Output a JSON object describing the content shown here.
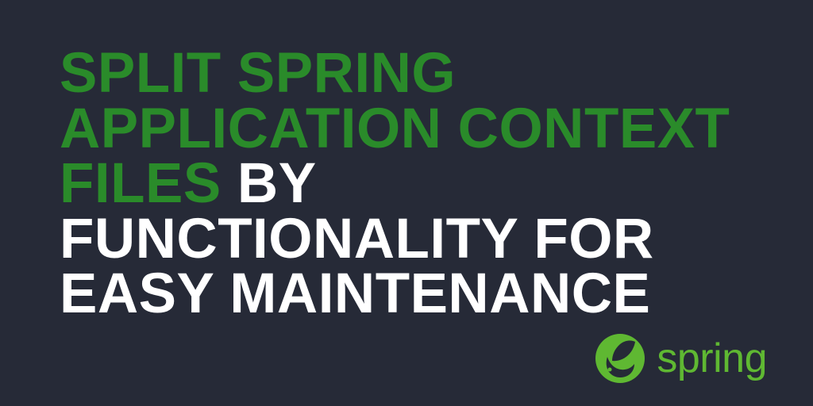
{
  "headline": {
    "emphasis": "Split Spring Application Context Files",
    "rest": " by Functionality for Easy Maintenance"
  },
  "logo": {
    "text": "spring"
  },
  "colors": {
    "background": "#262a37",
    "accent_green": "#2a8b2a",
    "logo_green": "#5fb832",
    "text_white": "#ffffff"
  }
}
